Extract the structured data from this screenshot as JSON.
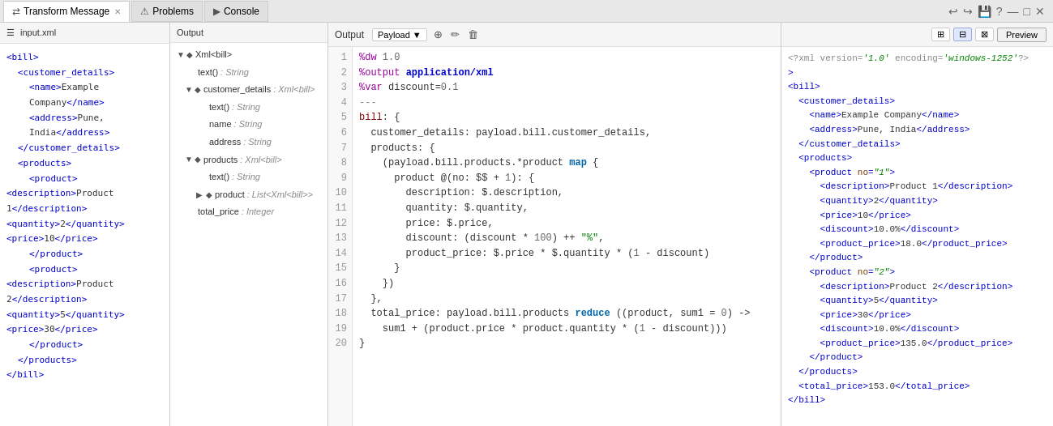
{
  "tabs": [
    {
      "id": "transform",
      "label": "Transform Message",
      "icon": "⇄",
      "active": true
    },
    {
      "id": "problems",
      "label": "Problems",
      "icon": "⚠",
      "active": false
    },
    {
      "id": "console",
      "label": "Console",
      "icon": "▶",
      "active": false
    }
  ],
  "toolbar_right": {
    "icons": [
      "↩",
      "↪",
      "💾",
      "?",
      "—",
      "□",
      "✕"
    ]
  },
  "left_panel": {
    "header": "input.xml",
    "content": "<bill>\n  <customer_details>\n    <name>Example Company</name>\n    <address>Pune, India</address>\n  </customer_details>\n  <products>\n    <product>\n<description>Product 1</description>\n<quantity>2</quantity>\n<price>10</price>\n    </product>\n    <product>\n<description>Product 2</description>\n<quantity>5</quantity>\n<price>30</price>\n    </product>\n  </products>\n</bill>"
  },
  "middle_panel": {
    "header": "Output",
    "tree": [
      {
        "indent": 0,
        "toggle": "▼",
        "name": "Xml<bill>",
        "type": "",
        "level": 0
      },
      {
        "indent": 1,
        "toggle": "",
        "name": "text()",
        "type": " : String",
        "level": 1
      },
      {
        "indent": 1,
        "toggle": "▼",
        "name": "customer_details",
        "type": " : Xml<bill>",
        "level": 1
      },
      {
        "indent": 2,
        "toggle": "",
        "name": "text()",
        "type": " : String",
        "level": 2
      },
      {
        "indent": 2,
        "toggle": "",
        "name": "name",
        "type": " : String",
        "level": 2
      },
      {
        "indent": 2,
        "toggle": "",
        "name": "address",
        "type": " : String",
        "level": 2
      },
      {
        "indent": 1,
        "toggle": "▼",
        "name": "products",
        "type": " : Xml<bill>",
        "level": 1
      },
      {
        "indent": 2,
        "toggle": "",
        "name": "text()",
        "type": " : String",
        "level": 2
      },
      {
        "indent": 2,
        "toggle": "▶",
        "name": "product",
        "type": " : List<Xml<bill>>",
        "level": 2
      },
      {
        "indent": 1,
        "toggle": "",
        "name": "total_price",
        "type": " : Integer",
        "level": 1
      }
    ]
  },
  "code_panel": {
    "output_label": "Output",
    "payload_label": "Payload",
    "lines": [
      {
        "no": 1,
        "code": "%dw 1.0"
      },
      {
        "no": 2,
        "code": "%output application/xml"
      },
      {
        "no": 3,
        "code": "%var discount=0.1"
      },
      {
        "no": 4,
        "code": "---"
      },
      {
        "no": 5,
        "code": "bill: {",
        "fold": true
      },
      {
        "no": 6,
        "code": "  customer_details: payload.bill.customer_details,"
      },
      {
        "no": 7,
        "code": "  products: {",
        "fold": true
      },
      {
        "no": 8,
        "code": "    (payload.bill.products.*product map {",
        "fold": true
      },
      {
        "no": 9,
        "code": "      product @(no: $$ + 1): {",
        "fold": true
      },
      {
        "no": 10,
        "code": "        description: $.description,"
      },
      {
        "no": 11,
        "code": "        quantity: $.quantity,"
      },
      {
        "no": 12,
        "code": "        price: $.price,"
      },
      {
        "no": 13,
        "code": "        discount: (discount * 100) ++ \"%\","
      },
      {
        "no": 14,
        "code": "        product_price: $.price * $.quantity * (1 - discount)"
      },
      {
        "no": 15,
        "code": "      }"
      },
      {
        "no": 16,
        "code": "    })"
      },
      {
        "no": 17,
        "code": "  },"
      },
      {
        "no": 18,
        "code": "  total_price: payload.bill.products reduce ((product, sum1 = 0) ->",
        "fold": true
      },
      {
        "no": 19,
        "code": "    sum1 + (product.price * product.quantity * (1 - discount)))"
      },
      {
        "no": 20,
        "code": "}"
      }
    ]
  },
  "right_panel": {
    "view_buttons": [
      "⊞",
      "⊟",
      "⊠"
    ],
    "preview_label": "Preview",
    "xml_content": "<?xml version='1.0' encoding='windows-1252'?>\n<bill>\n  <customer_details>\n    <name>Example Company</name>\n    <address>Pune, India</address>\n  </customer_details>\n  <products>\n    <product no=\"1\">\n      <description>Product 1</description>\n      <quantity>2</quantity>\n      <price>10</price>\n      <discount>10.0%</discount>\n      <product_price>18.0</product_price>\n    </product>\n    <product no=\"2\">\n      <description>Product 2</description>\n      <quantity>5</quantity>\n      <price>30</price>\n      <discount>10.0%</discount>\n      <product_price>135.0</product_price>\n    </product>\n  </products>\n  <total_price>153.0</total_price>\n</bill>"
  }
}
